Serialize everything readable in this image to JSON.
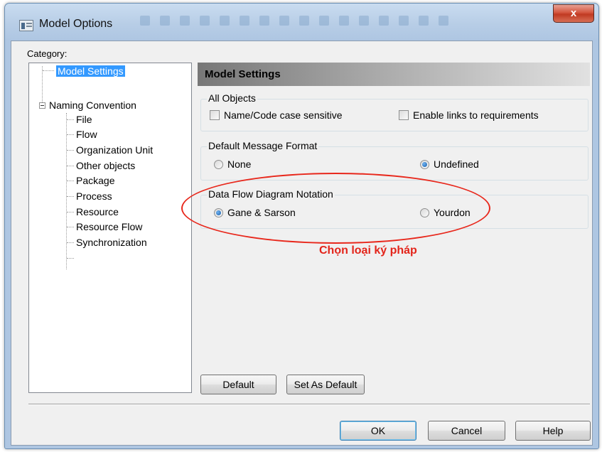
{
  "window": {
    "title": "Model Options",
    "close_label": "x"
  },
  "category": {
    "label": "Category:",
    "items": [
      {
        "label": "Model Settings",
        "selected": true,
        "level": 0
      },
      {
        "label": "Naming Convention",
        "expanded": true,
        "level": 0
      },
      {
        "label": "File",
        "level": 1
      },
      {
        "label": "Flow",
        "level": 1
      },
      {
        "label": "Organization Unit",
        "level": 1
      },
      {
        "label": "Other objects",
        "level": 1
      },
      {
        "label": "Package",
        "level": 1
      },
      {
        "label": "Process",
        "level": 1
      },
      {
        "label": "Resource",
        "level": 1
      },
      {
        "label": "Resource Flow",
        "level": 1
      },
      {
        "label": "Synchronization",
        "level": 1
      }
    ]
  },
  "panel": {
    "title": "Model Settings",
    "all_objects": {
      "legend": "All Objects",
      "case_sensitive": {
        "label": "Name/Code case sensitive",
        "checked": false
      },
      "enable_links": {
        "label": "Enable links to requirements",
        "checked": false
      }
    },
    "message_format": {
      "legend": "Default Message Format",
      "options": [
        {
          "label": "None",
          "selected": false
        },
        {
          "label": "Undefined",
          "selected": true
        }
      ]
    },
    "dfd_notation": {
      "legend": "Data Flow Diagram Notation",
      "options": [
        {
          "label": "Gane & Sarson",
          "selected": true
        },
        {
          "label": "Yourdon",
          "selected": false
        }
      ]
    },
    "default_button": "Default",
    "set_as_default_button": "Set As Default"
  },
  "annotation": {
    "text": "Chọn loại ký pháp",
    "color": "#e3241a"
  },
  "footer": {
    "ok": "OK",
    "cancel": "Cancel",
    "help": "Help"
  }
}
